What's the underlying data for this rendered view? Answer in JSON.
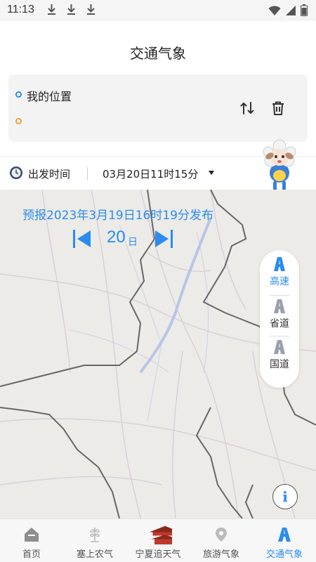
{
  "status_bar": {
    "time": "11:13"
  },
  "header": {
    "title": "交通气象"
  },
  "route": {
    "from_label": "我的位置",
    "to_label": ""
  },
  "departure": {
    "label": "出发时间",
    "value": "03月20日11时15分"
  },
  "map": {
    "forecast_text": "预报2023年3月19日16时19分发布",
    "day_value": "20",
    "day_unit": "日"
  },
  "road_types": [
    {
      "label": "高速",
      "active": true
    },
    {
      "label": "省道",
      "active": false
    },
    {
      "label": "国道",
      "active": false
    }
  ],
  "bottom_nav": [
    {
      "label": "首页",
      "active": false
    },
    {
      "label": "塞上农气",
      "active": false
    },
    {
      "label": "宁夏追天气",
      "active": false
    },
    {
      "label": "旅游气象",
      "active": false
    },
    {
      "label": "交通气象",
      "active": true
    }
  ],
  "colors": {
    "accent": "#2a8cf0",
    "start_dot": "#2a8cf0",
    "end_dot": "#f0a030"
  },
  "icons": {
    "download": "download-icon",
    "wifi": "wifi-icon",
    "signal": "signal-icon",
    "battery": "battery-icon",
    "swap": "swap-icon",
    "delete": "trash-icon",
    "clock": "clock-icon",
    "info": "info-icon"
  }
}
